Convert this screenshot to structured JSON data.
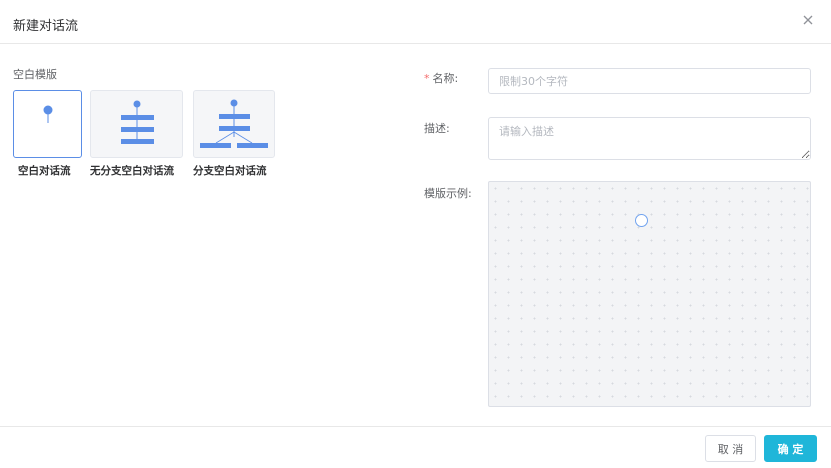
{
  "dialog": {
    "title": "新建对话流",
    "close_icon": "close-icon"
  },
  "templates": {
    "section_label": "空白模版",
    "items": [
      {
        "name": "空白对话流",
        "selected": true,
        "icon": "single-node-flow-icon"
      },
      {
        "name": "无分支空白对话流",
        "selected": false,
        "icon": "linear-flow-icon"
      },
      {
        "name": "分支空白对话流",
        "selected": false,
        "icon": "branch-flow-icon"
      }
    ]
  },
  "form": {
    "name_label": "名称:",
    "name_required_mark": "*",
    "name_value": "",
    "name_placeholder": "限制30个字符",
    "desc_label": "描述:",
    "desc_value": "",
    "desc_placeholder": "请输入描述",
    "preview_label": "模版示例:"
  },
  "footer": {
    "cancel_label": "取 消",
    "ok_label": "确 定"
  },
  "colors": {
    "accent": "#1fb6d9",
    "node_blue": "#5b8ee6",
    "required": "#f56c6c"
  }
}
